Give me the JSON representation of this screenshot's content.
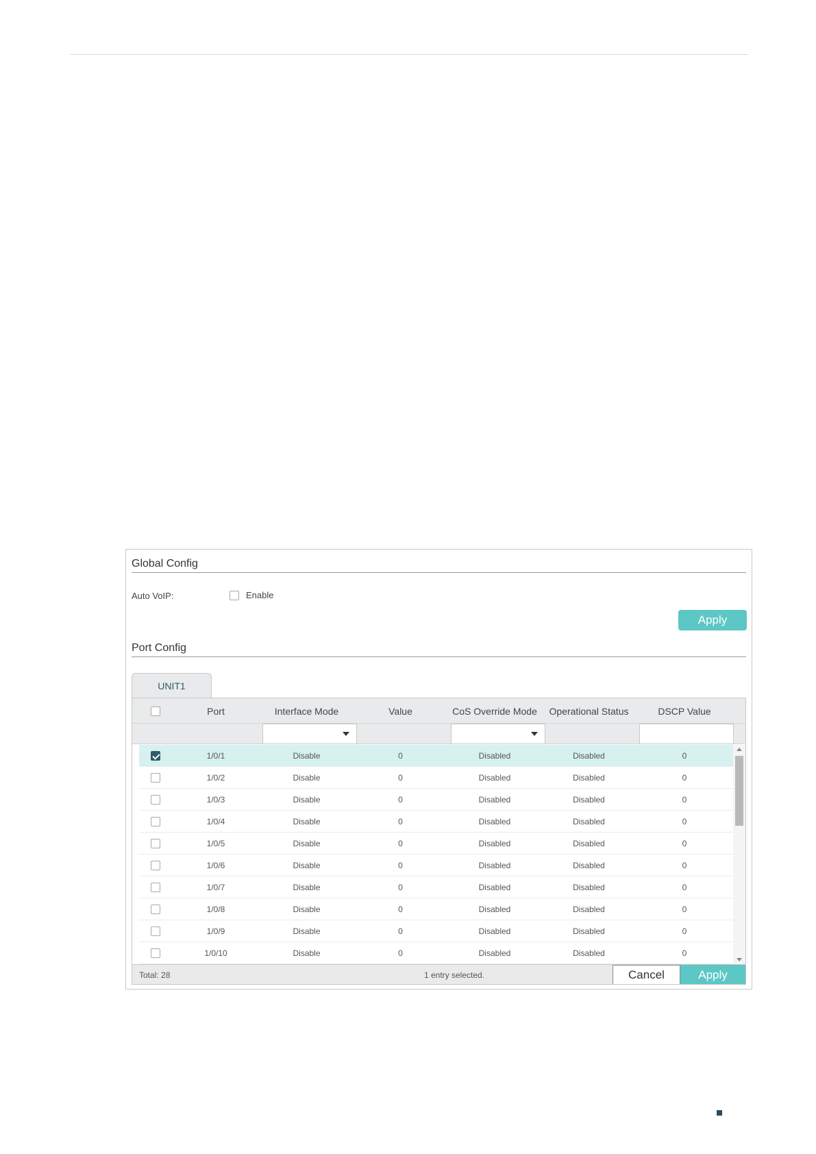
{
  "global_config": {
    "title": "Global Config",
    "auto_voip_label": "Auto VoIP:",
    "enable_label": "Enable",
    "enable_checked": false,
    "apply_label": "Apply"
  },
  "port_config": {
    "title": "Port Config",
    "tab_label": "UNIT1",
    "columns": [
      "Port",
      "Interface Mode",
      "Value",
      "CoS Override Mode",
      "Operational Status",
      "DSCP Value"
    ],
    "rows": [
      {
        "port": "1/0/1",
        "interface_mode": "Disable",
        "value": "0",
        "cos_override_mode": "Disabled",
        "operational_status": "Disabled",
        "dscp_value": "0",
        "checked": true
      },
      {
        "port": "1/0/2",
        "interface_mode": "Disable",
        "value": "0",
        "cos_override_mode": "Disabled",
        "operational_status": "Disabled",
        "dscp_value": "0",
        "checked": false
      },
      {
        "port": "1/0/3",
        "interface_mode": "Disable",
        "value": "0",
        "cos_override_mode": "Disabled",
        "operational_status": "Disabled",
        "dscp_value": "0",
        "checked": false
      },
      {
        "port": "1/0/4",
        "interface_mode": "Disable",
        "value": "0",
        "cos_override_mode": "Disabled",
        "operational_status": "Disabled",
        "dscp_value": "0",
        "checked": false
      },
      {
        "port": "1/0/5",
        "interface_mode": "Disable",
        "value": "0",
        "cos_override_mode": "Disabled",
        "operational_status": "Disabled",
        "dscp_value": "0",
        "checked": false
      },
      {
        "port": "1/0/6",
        "interface_mode": "Disable",
        "value": "0",
        "cos_override_mode": "Disabled",
        "operational_status": "Disabled",
        "dscp_value": "0",
        "checked": false
      },
      {
        "port": "1/0/7",
        "interface_mode": "Disable",
        "value": "0",
        "cos_override_mode": "Disabled",
        "operational_status": "Disabled",
        "dscp_value": "0",
        "checked": false
      },
      {
        "port": "1/0/8",
        "interface_mode": "Disable",
        "value": "0",
        "cos_override_mode": "Disabled",
        "operational_status": "Disabled",
        "dscp_value": "0",
        "checked": false
      },
      {
        "port": "1/0/9",
        "interface_mode": "Disable",
        "value": "0",
        "cos_override_mode": "Disabled",
        "operational_status": "Disabled",
        "dscp_value": "0",
        "checked": false
      },
      {
        "port": "1/0/10",
        "interface_mode": "Disable",
        "value": "0",
        "cos_override_mode": "Disabled",
        "operational_status": "Disabled",
        "dscp_value": "0",
        "checked": false
      }
    ],
    "footer": {
      "total": "Total: 28",
      "selected_text": "1 entry selected.",
      "cancel_label": "Cancel",
      "apply_label": "Apply"
    }
  },
  "colors": {
    "accent": "#5cc7c4",
    "selected_row": "#d6f1ef",
    "header_bg": "#e9eaeb",
    "checkbox_checked": "#2f5a6b"
  },
  "icons": [
    "checkbox-icon",
    "chevron-down-icon",
    "scroll-up-icon",
    "scroll-down-icon"
  ]
}
